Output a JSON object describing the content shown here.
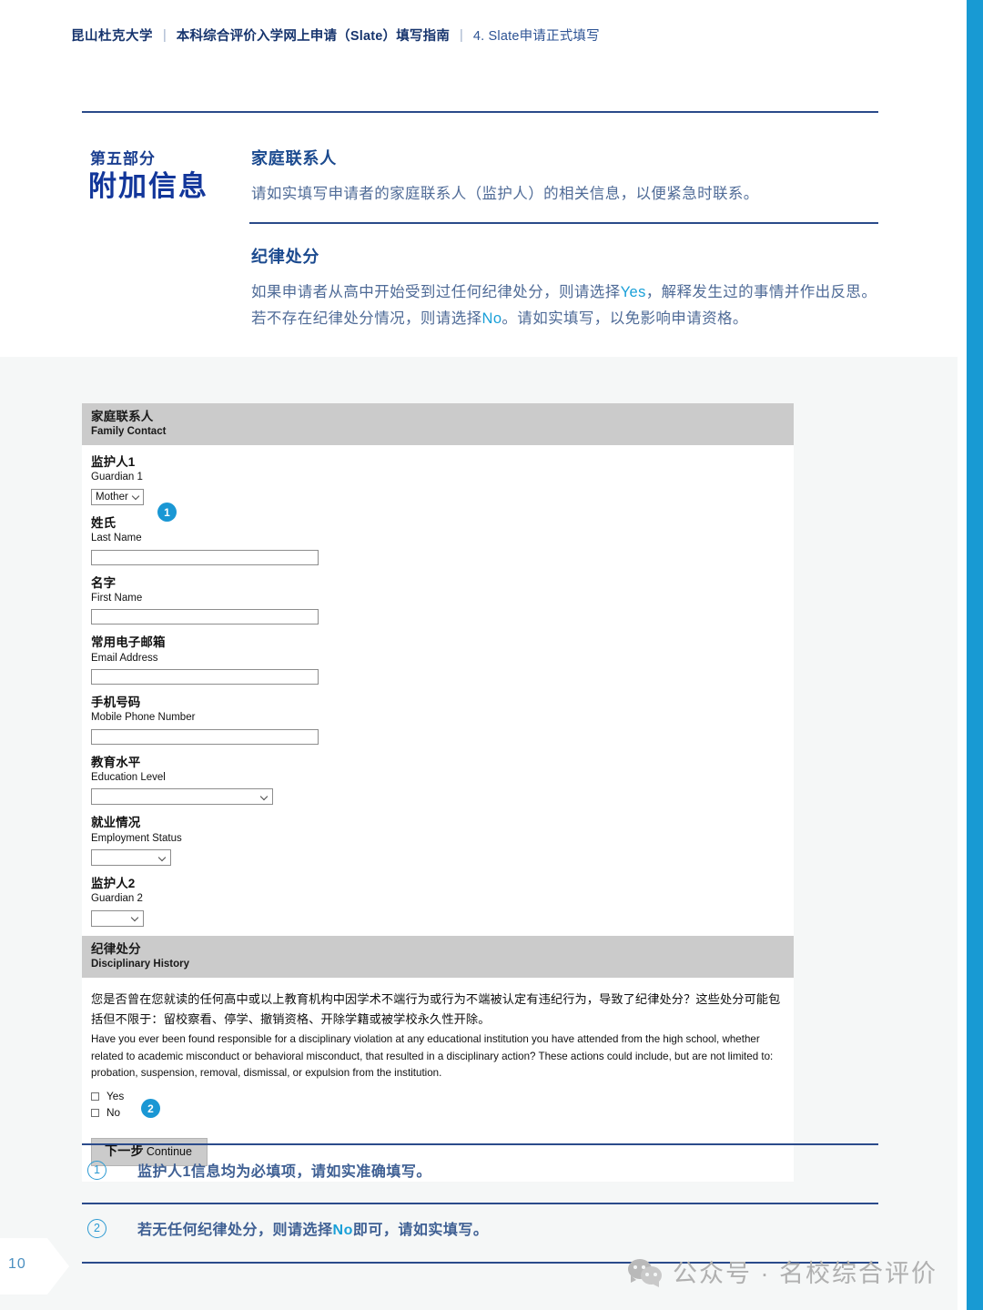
{
  "breadcrumb": {
    "brand": "昆山杜克大学",
    "separator": "|",
    "crumb2": "本科综合评价入学网上申请（Slate）填写指南",
    "crumb3": "4. Slate申请正式填写"
  },
  "section": {
    "kicker": "第五部分",
    "title": "附加信息"
  },
  "intro": [
    {
      "heading": "家庭联系人",
      "body": "请如实填写申请者的家庭联系人（监护人）的相关信息，以便紧急时联系。"
    }
  ],
  "intro_discipline": {
    "heading": "纪律处分",
    "body_1": "如果申请者从高中开始受到过任何纪律处分，则请选择",
    "hl_1": "Yes",
    "body_2": "，解释发生过的事情并作出反思。若不存在纪律处分情况，则请选择",
    "hl_2": "No",
    "body_3": "。请如实填写，以免影响申请资格。"
  },
  "form": {
    "family_contact_bar": {
      "zh": "家庭联系人",
      "en": "Family Contact"
    },
    "fields": [
      {
        "zh": "监护人1",
        "en": "Guardian 1",
        "control": "select",
        "value": "Mother",
        "badge": "1"
      },
      {
        "zh": "姓氏",
        "en": "Last Name",
        "control": "text",
        "value": ""
      },
      {
        "zh": "名字",
        "en": "First Name",
        "control": "text",
        "value": ""
      },
      {
        "zh": "常用电子邮箱",
        "en": "Email Address",
        "control": "text",
        "value": ""
      },
      {
        "zh": "手机号码",
        "en": "Mobile Phone Number",
        "control": "text",
        "value": ""
      },
      {
        "zh": "教育水平",
        "en": "Education Level",
        "control": "select",
        "value": ""
      },
      {
        "zh": "就业情况",
        "en": "Employment Status",
        "control": "select",
        "value": ""
      },
      {
        "zh": "监护人2",
        "en": "Guardian 2",
        "control": "select",
        "value": ""
      }
    ],
    "disciplinary_bar": {
      "zh": "纪律处分",
      "en": "Disciplinary History"
    },
    "disciplinary_question_zh": "您是否曾在您就读的任何高中或以上教育机构中因学术不端行为或行为不端被认定有违纪行为，导致了纪律处分？这些处分可能包括但不限于：留校察看、停学、撤销资格、开除学籍或被学校永久性开除。",
    "disciplinary_question_en": "Have you ever been found responsible for a disciplinary violation at any educational institution you have attended from the high school, whether related to academic misconduct or behavioral misconduct, that resulted in a disciplinary action? These actions could include, but are not limited to: probation, suspension, removal, dismissal, or expulsion from the institution.",
    "choices": [
      {
        "label": "Yes",
        "checked": false
      },
      {
        "label": "No",
        "checked": false,
        "badge": "2"
      }
    ],
    "continue_button": {
      "zh": "下一步",
      "en": "Continue"
    }
  },
  "footnotes": [
    {
      "num": "1",
      "text_1": "监护人1信息均为必填项，请如实准确填写。",
      "hl": "",
      "text_2": ""
    },
    {
      "num": "2",
      "text_1": "若无任何纪律处分，则请选择",
      "hl": "No",
      "text_2": "即可，请如实填写。"
    }
  ],
  "page_number": "10",
  "watermark": {
    "text": "公众号 · 名校综合评价"
  },
  "colors": {
    "edge_strip": "#189ad3",
    "rule_navy": "#2a4a8a",
    "section_title": "#12369a",
    "accent_blue": "#1aa0d8",
    "badge_blue": "#1a97d4",
    "bar_gray": "#cbcbcb",
    "page_tint": "#f5f7f7"
  }
}
